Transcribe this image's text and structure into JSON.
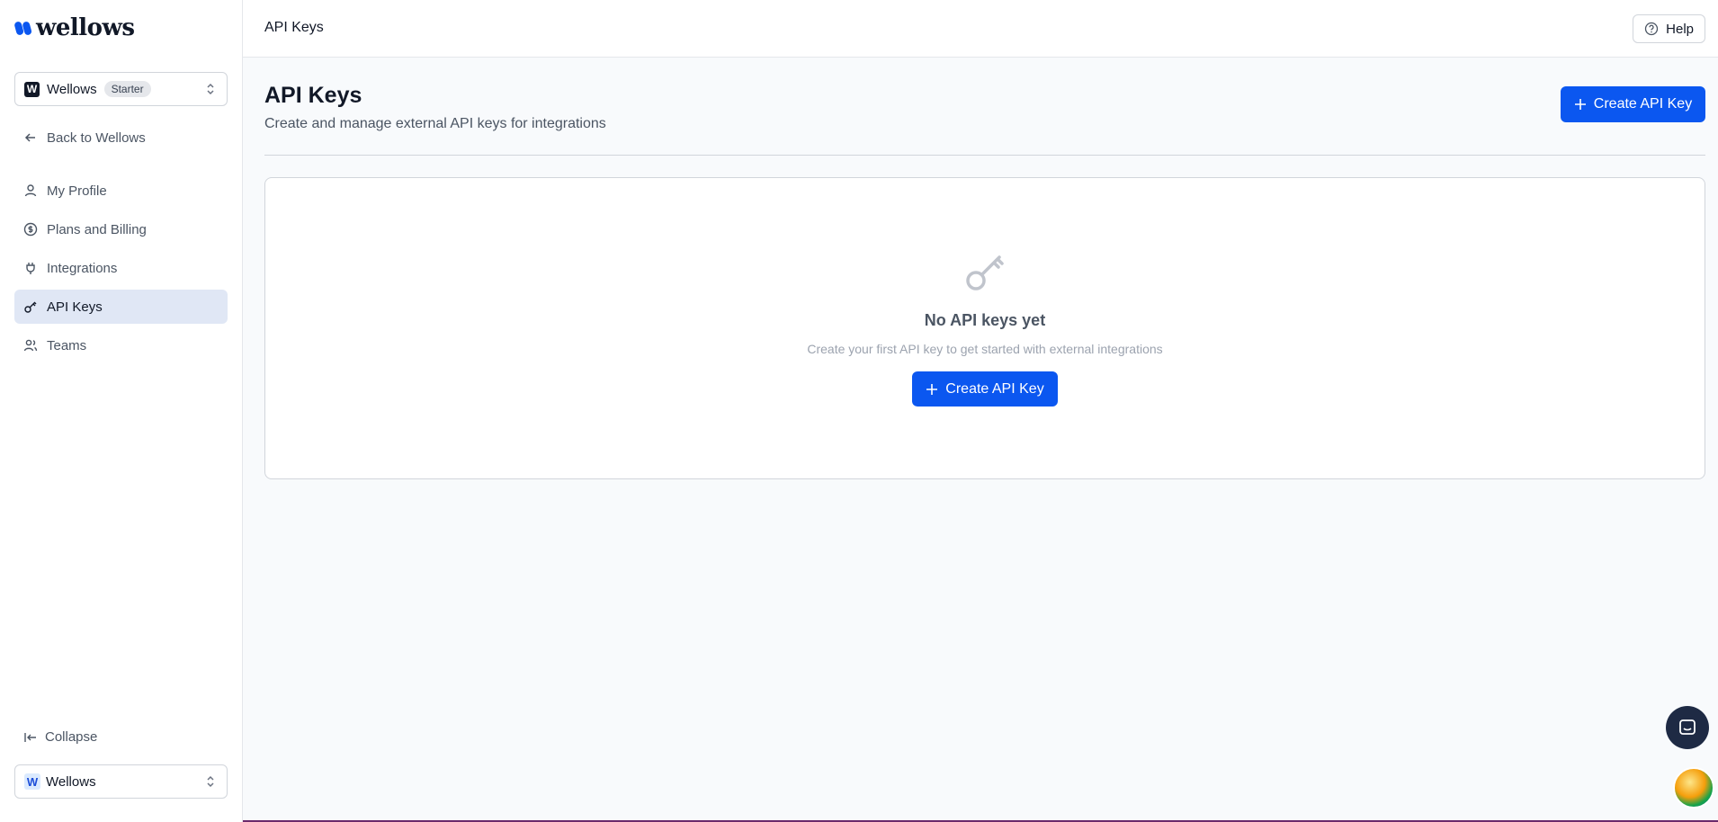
{
  "brand": {
    "logo_text": "wellows",
    "logo_color": "#0b57f0"
  },
  "sidebar": {
    "org_switcher": {
      "badge": "W",
      "name": "Wellows",
      "plan": "Starter"
    },
    "back_link": "Back to Wellows",
    "items": [
      {
        "label": "My Profile",
        "icon": "user-icon",
        "active": false
      },
      {
        "label": "Plans and Billing",
        "icon": "dollar-icon",
        "active": false
      },
      {
        "label": "Integrations",
        "icon": "plug-icon",
        "active": false
      },
      {
        "label": "API Keys",
        "icon": "key-icon",
        "active": true
      },
      {
        "label": "Teams",
        "icon": "users-icon",
        "active": false
      }
    ],
    "collapse_label": "Collapse",
    "bottom_org": {
      "badge": "W",
      "name": "Wellows"
    }
  },
  "topbar": {
    "title": "API Keys",
    "help_label": "Help"
  },
  "main": {
    "title": "API Keys",
    "subtitle": "Create and manage external API keys for integrations",
    "create_button": "Create API Key",
    "empty_state": {
      "title": "No API keys yet",
      "description": "Create your first API key to get started with external integrations",
      "button": "Create API Key"
    }
  },
  "colors": {
    "primary": "#0b57f0",
    "active_nav_bg": "#e0e7f5",
    "chat_bubble": "#1e2a44"
  }
}
